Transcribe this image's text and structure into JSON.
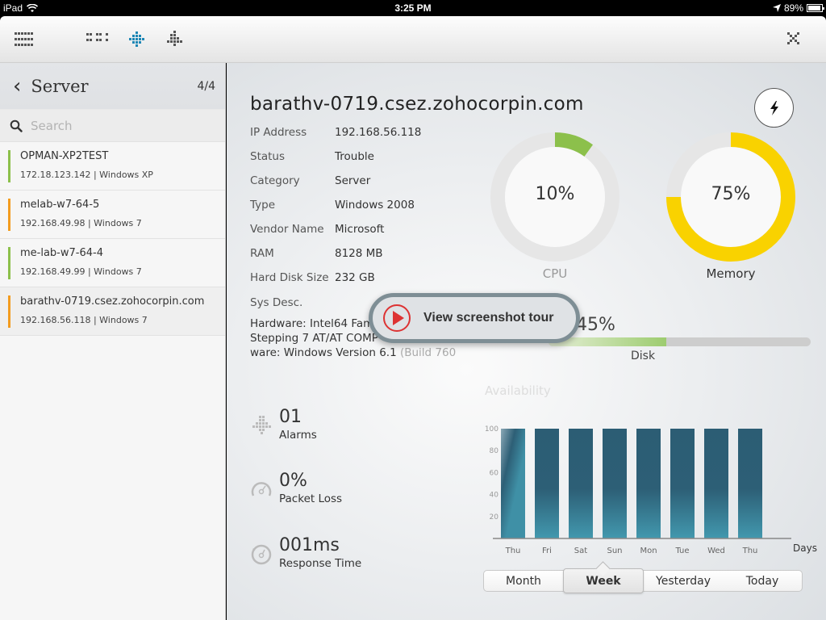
{
  "status_bar": {
    "device": "iPad",
    "time": "3:25 PM",
    "battery": "89%"
  },
  "toolbar": {
    "icons": [
      "list-view-icon",
      "grid-view-icon",
      "network-view-icon",
      "alarm-view-icon",
      "close-icon"
    ],
    "active_icon": "network-view-icon"
  },
  "sidebar": {
    "title": "Server",
    "count": "4/4",
    "search_placeholder": "Search",
    "search_value": "",
    "items": [
      {
        "name": "OPMAN-XP2TEST",
        "sub": "172.18.123.142 | Windows XP",
        "status_color": "#8cc04b",
        "selected": false
      },
      {
        "name": "melab-w7-64-5",
        "sub": "192.168.49.98 | Windows 7",
        "status_color": "#f39c1f",
        "selected": false
      },
      {
        "name": "me-lab-w7-64-4",
        "sub": "192.168.49.99 | Windows 7",
        "status_color": "#8cc04b",
        "selected": false
      },
      {
        "name": "barathv-0719.csez.zohocorpin.com",
        "sub": "192.168.56.118 | Windows 7",
        "status_color": "#f39c1f",
        "selected": true
      }
    ]
  },
  "device": {
    "title": "barathv-0719.csez.zohocorpin.com",
    "properties": [
      {
        "label": "IP Address",
        "value": "192.168.56.118"
      },
      {
        "label": "Status",
        "value": "Trouble"
      },
      {
        "label": "Category",
        "value": "Server"
      },
      {
        "label": "Type",
        "value": "Windows 2008"
      },
      {
        "label": "Vendor Name",
        "value": "Microsoft"
      },
      {
        "label": "RAM",
        "value": "8128 MB"
      },
      {
        "label": "Hard Disk Size",
        "value": "232 GB"
      }
    ],
    "sys_desc_label": "Sys Desc.",
    "sys_desc_lines": [
      "Hardware: Intel64 Fam",
      "Stepping 7 AT/AT COMP",
      "ware: Windows Version 6.1 ",
      "(Build 760"
    ]
  },
  "gauges": {
    "cpu": {
      "label": "CPU",
      "percent": 10,
      "display": "10%",
      "color": "#8cc04b"
    },
    "memory": {
      "label": "Memory",
      "percent": 75,
      "display": "75%",
      "color": "#f9d200"
    }
  },
  "disk": {
    "label": "Disk",
    "percent": 45,
    "display": "45%"
  },
  "tour_button": {
    "label": "View screenshot tour"
  },
  "stats": [
    {
      "value": "01",
      "label": "Alarms",
      "icon": "alarm-icon"
    },
    {
      "value": "0%",
      "label": "Packet Loss",
      "icon": "gauge-icon"
    },
    {
      "value": "001ms",
      "label": "Response Time",
      "icon": "timer-icon"
    }
  ],
  "period_selector": {
    "options": [
      "Month",
      "Week",
      "Yesterday",
      "Today"
    ],
    "selected": "Week"
  },
  "chart_data": {
    "type": "bar",
    "title": "Availability",
    "xlabel": "Days",
    "ylabel": "",
    "categories": [
      "Thu",
      "Fri",
      "Sat",
      "Sun",
      "Mon",
      "Tue",
      "Wed",
      "Thu"
    ],
    "values": [
      100,
      100,
      100,
      100,
      100,
      100,
      100,
      100
    ],
    "yticks": [
      20,
      40,
      60,
      80,
      100
    ],
    "ylim": [
      0,
      100
    ],
    "grid": false,
    "colors": {
      "bar_top": "#2c5d74",
      "bar_bottom": "#4196ad"
    }
  }
}
